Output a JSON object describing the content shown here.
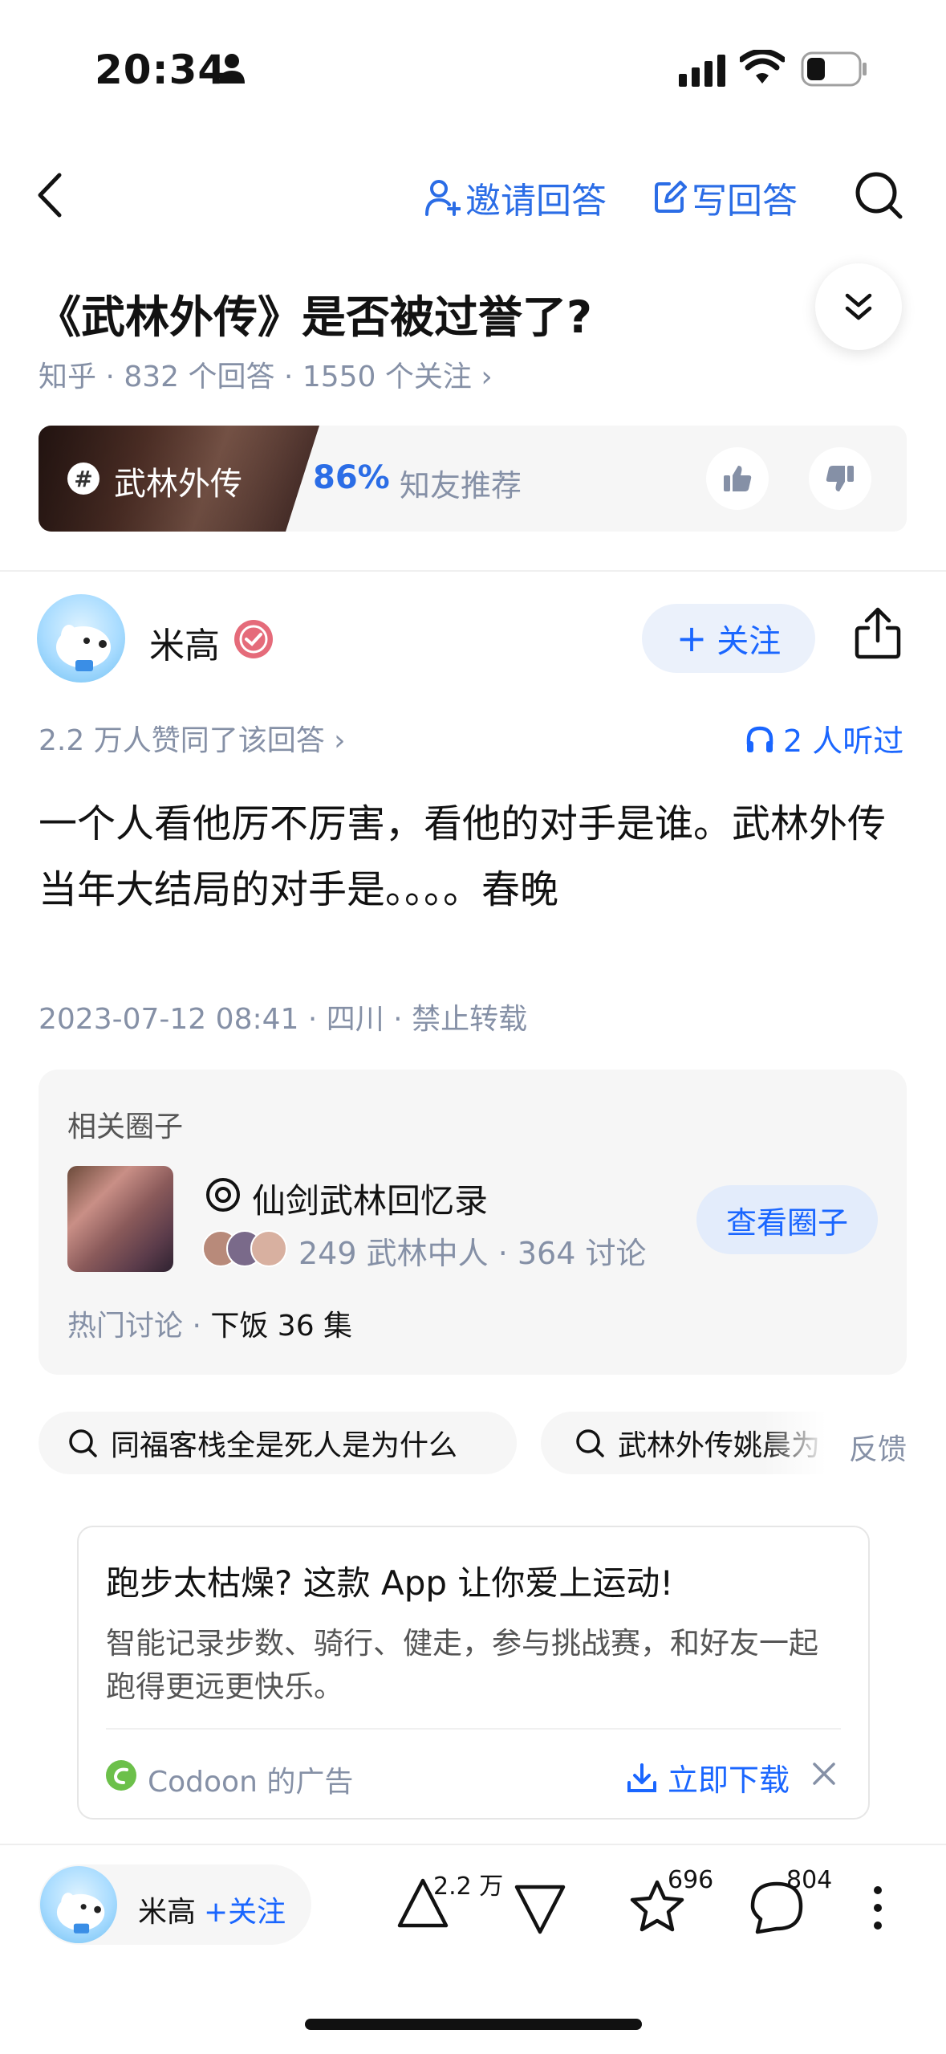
{
  "status": {
    "time": "20:34"
  },
  "nav": {
    "invite_label": "邀请回答",
    "write_label": "写回答"
  },
  "question": {
    "title": "《武林外传》是否被过誉了?",
    "meta": "知乎 · 832 个回答 · 1550 个关注 ›"
  },
  "topic": {
    "name": "武林外传",
    "percent": "86%",
    "recommend_text": "知友推荐"
  },
  "answer": {
    "author": "米高",
    "follow_label": "关注",
    "likes_text": "2.2 万人赞同了该回答 ›",
    "listen_text": "2 人听过",
    "content": "一个人看他厉不厉害，看他的对手是谁。武林外传当年大结局的对手是。。。。春晚",
    "date_meta": "2023-07-12 08:41 · 四川 · 禁止转载"
  },
  "circle": {
    "heading": "相关圈子",
    "name": "仙剑武林回忆录",
    "stats": "249 武林中人 · 364 讨论",
    "hot_label": "热门讨论 · ",
    "hot_value": "下饭 36 集",
    "button": "查看圈子"
  },
  "searches": {
    "chip1": "同福客栈全是死人是为什么",
    "chip2": "武林外传姚晨为",
    "feedback": "反馈"
  },
  "ad": {
    "title": "跑步太枯燥? 这款 App 让你爱上运动!",
    "body": "智能记录步数、骑行、健走，参与挑战赛，和好友一起跑得更远更快乐。",
    "sponsor": "Codoon 的广告",
    "download": "立即下载"
  },
  "bottom": {
    "author": "米高",
    "follow": "+关注",
    "upvotes": "2.2 万",
    "favorites": "696",
    "comments": "804"
  },
  "colors": {
    "accent": "#1a66ff",
    "meta_grey": "#8590a6"
  },
  "icons": [
    "back-icon",
    "invite-person-icon",
    "edit-icon",
    "search-icon",
    "collapse-chevrons-icon",
    "hashtag-icon",
    "thumb-up-icon",
    "thumb-down-icon",
    "verified-badge-icon",
    "share-icon",
    "headphone-icon",
    "circle-icon",
    "search-small-icon",
    "download-icon",
    "close-icon",
    "upvote-icon",
    "downvote-icon",
    "star-icon",
    "comment-icon",
    "more-icon"
  ]
}
